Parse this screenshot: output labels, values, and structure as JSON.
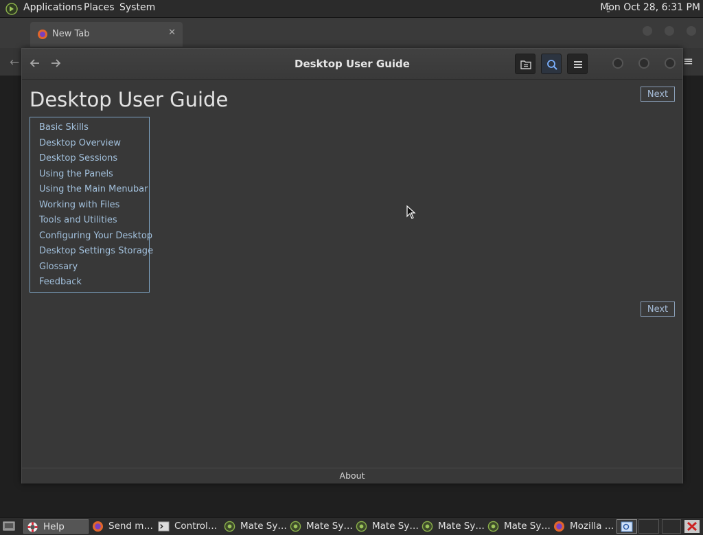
{
  "top_panel": {
    "menus": [
      "Applications",
      "Places",
      "System"
    ],
    "clock": "Mon Oct 28,  6:31 PM"
  },
  "browser": {
    "tab_title": "New Tab",
    "tab_close": "✕"
  },
  "help_window": {
    "title": "Desktop User Guide",
    "page_title": "Desktop User Guide",
    "next_label": "Next",
    "toc": [
      "Basic Skills",
      "Desktop Overview",
      "Desktop Sessions",
      "Using the Panels",
      "Using the Main Menubar",
      "Working with Files",
      "Tools and Utilities",
      "Configuring Your Desktop",
      "Desktop Settings Storage",
      "Glossary",
      "Feedback"
    ],
    "footer": "About",
    "link_color": "#a2c0dc"
  },
  "taskbar": [
    {
      "label": "Help",
      "icon": "help-lifebuoy-icon",
      "active": true
    },
    {
      "label": "Send m…",
      "icon": "firefox-icon"
    },
    {
      "label": "Control…",
      "icon": "terminal-icon"
    },
    {
      "label": "Mate Sy…",
      "icon": "mate-logo-icon"
    },
    {
      "label": "Mate Sy…",
      "icon": "mate-logo-icon"
    },
    {
      "label": "Mate Sy…",
      "icon": "mate-logo-icon"
    },
    {
      "label": "Mate Sy…",
      "icon": "mate-logo-icon"
    },
    {
      "label": "Mate Sy…",
      "icon": "mate-logo-icon"
    },
    {
      "label": "Mozilla …",
      "icon": "firefox-icon"
    }
  ]
}
